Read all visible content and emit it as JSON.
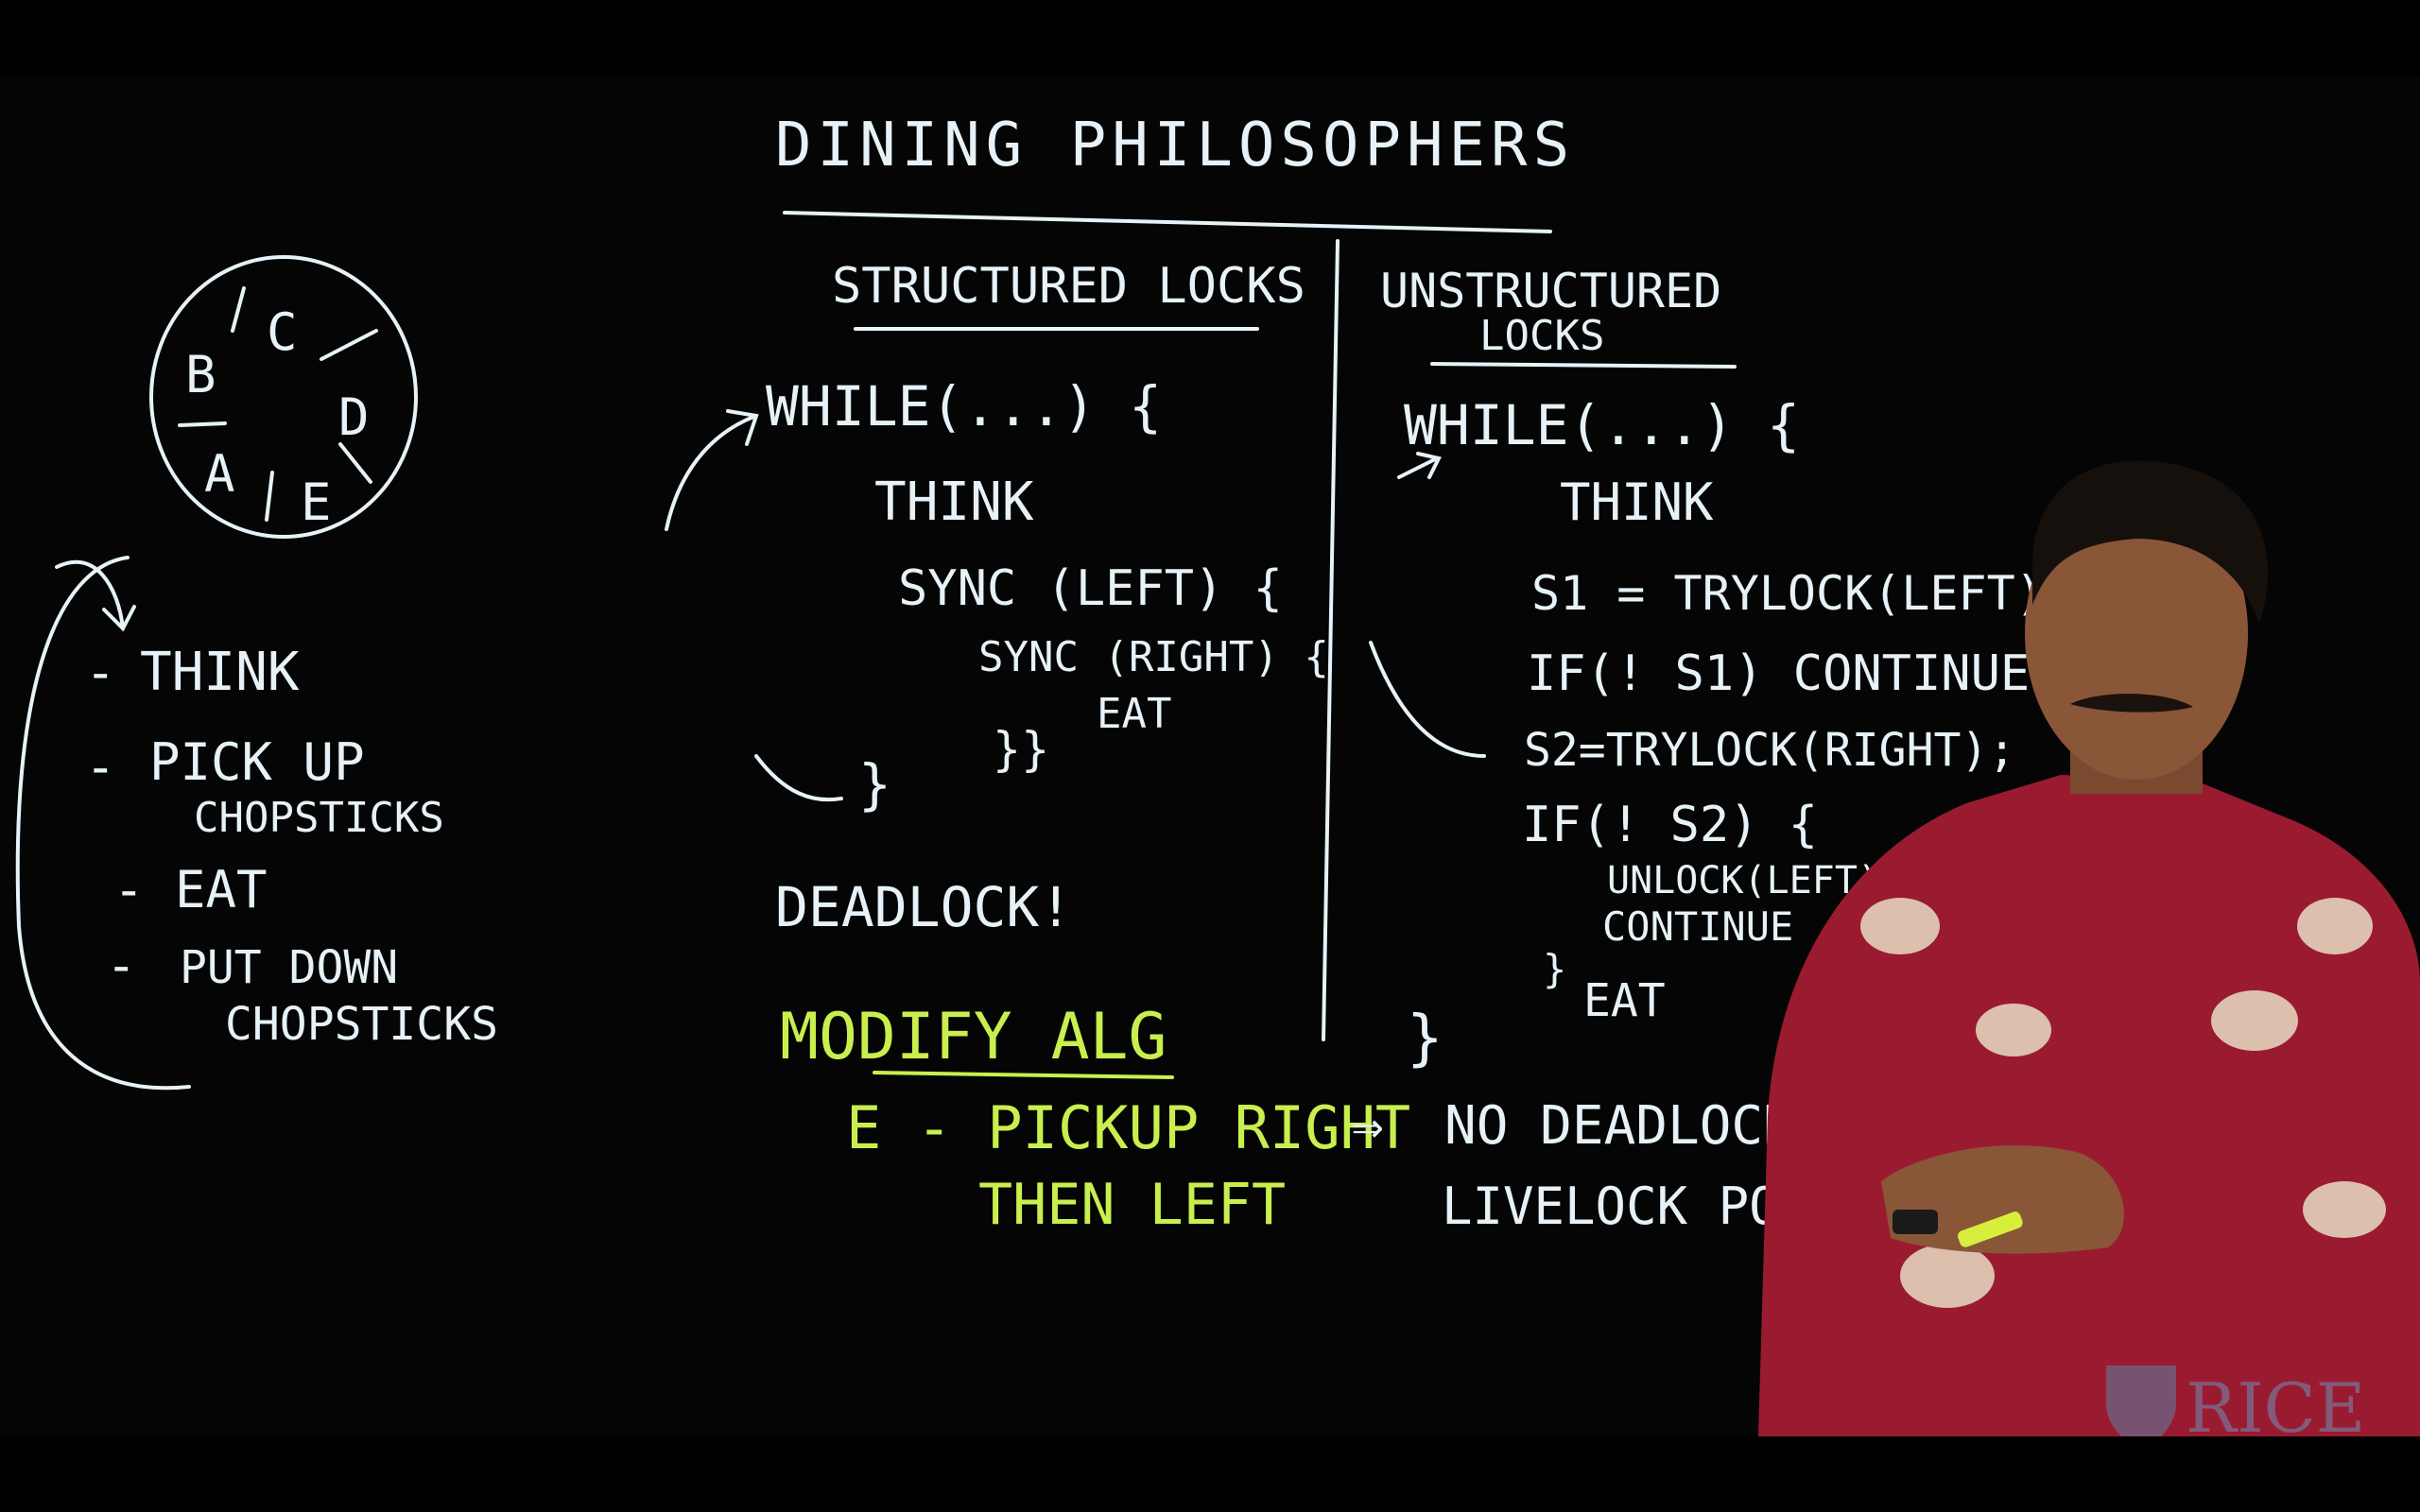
{
  "board": {
    "title": "DINING PHILOSOPHERS",
    "table_labels": [
      "B",
      "C",
      "D",
      "A",
      "E"
    ],
    "steps": [
      "THINK",
      "PICK UP",
      "CHOPSTICKS",
      "EAT",
      "PUT DOWN",
      "CHOPSTICKS"
    ],
    "structured": {
      "heading": "STRUCTURED LOCKS",
      "lines": [
        "WHILE(...) {",
        "THINK",
        "SYNC (LEFT) {",
        "SYNC (RIGHT) {",
        "EAT",
        "}}",
        "}"
      ],
      "deadlock": "DEADLOCK!"
    },
    "unstructured": {
      "heading_1": "UNSTRUCTURED",
      "heading_2": "LOCKS",
      "lines": [
        "WHILE(...) {",
        "THINK",
        "S1 = TRYLOCK(LEFT)",
        "IF(! S1) CONTINUE;",
        "S2=TRYLOCK(RIGHT);",
        "IF(! S2) {",
        "UNLOCK(LEFT)",
        "CONTINUE",
        "}",
        "EAT",
        "}"
      ]
    },
    "modify": {
      "heading": "MODIFY ALG",
      "line_1": "E - PICKUP RIGHT",
      "line_2": "THEN LEFT"
    },
    "result": {
      "line_1": "NO DEADLOCK",
      "line_2": "LIVELOCK POSSIBLE"
    },
    "watermark": "RICE"
  },
  "colors": {
    "chalk": "#e6f2f7",
    "green": "#c9ef4f",
    "shirt": "#9a1b30",
    "skin": "#8a5638"
  }
}
